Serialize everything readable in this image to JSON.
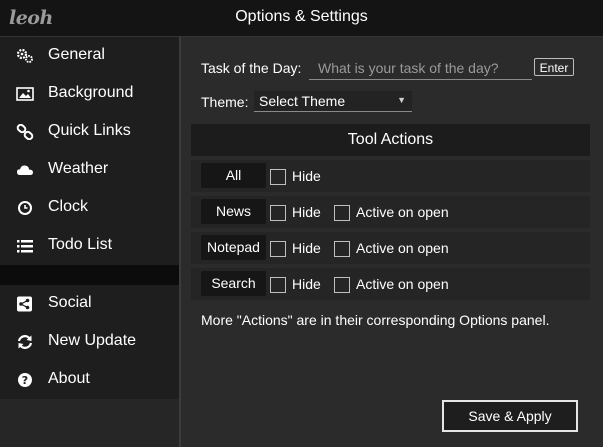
{
  "app": {
    "logo": "leoh",
    "title": "Options & Settings"
  },
  "sidebar": {
    "items": [
      {
        "label": "General",
        "icon": "gears-icon"
      },
      {
        "label": "Background",
        "icon": "image-icon"
      },
      {
        "label": "Quick Links",
        "icon": "link-icon"
      },
      {
        "label": "Weather",
        "icon": "cloud-icon"
      },
      {
        "label": "Clock",
        "icon": "clock-icon"
      },
      {
        "label": "Todo List",
        "icon": "list-icon"
      }
    ],
    "bottom_items": [
      {
        "label": "Social",
        "icon": "share-icon"
      },
      {
        "label": "New Update",
        "icon": "refresh-icon"
      },
      {
        "label": "About",
        "icon": "question-icon"
      }
    ]
  },
  "main": {
    "task": {
      "label": "Task of the Day:",
      "placeholder": "What is your task of the day?",
      "button": "Enter"
    },
    "theme": {
      "label": "Theme:",
      "selected": "Select Theme"
    },
    "tool_actions": {
      "heading": "Tool Actions",
      "rows": [
        {
          "name": "All",
          "hide_label": "Hide"
        },
        {
          "name": "News",
          "hide_label": "Hide",
          "active_label": "Active on open"
        },
        {
          "name": "Notepad",
          "hide_label": "Hide",
          "active_label": "Active on open"
        },
        {
          "name": "Search",
          "hide_label": "Hide",
          "active_label": "Active on open"
        }
      ],
      "note": "More \"Actions\" are in their corresponding Options panel."
    },
    "save_button": "Save & Apply"
  },
  "colors": {
    "background": "#2b2b2b",
    "sidebar": "#1e1e1e",
    "titlebar": "#141414",
    "text": "#ffffff"
  }
}
